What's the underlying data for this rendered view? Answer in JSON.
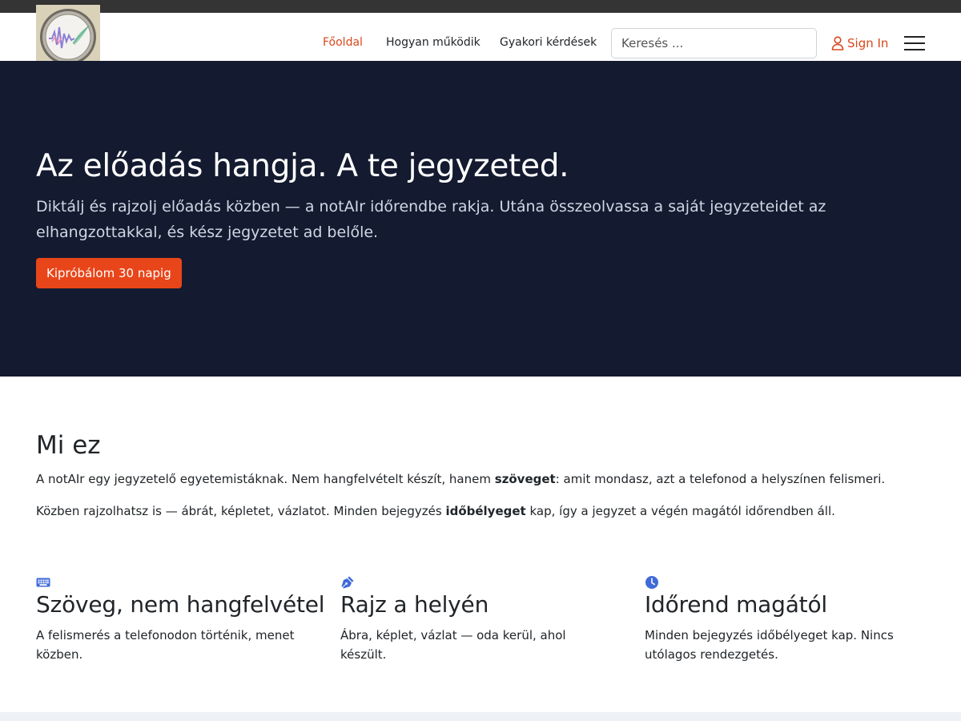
{
  "nav": {
    "items": [
      {
        "label": "Főoldal",
        "active": true
      },
      {
        "label": "Hogyan működik",
        "active": false
      },
      {
        "label": "Gyakori kérdések",
        "active": false
      }
    ],
    "search_placeholder": "Keresés ...",
    "signin_label": "Sign In",
    "accent_color": "#d9481b"
  },
  "hero": {
    "title": "Az előadás hangja. A te jegyzeted.",
    "subtitle": "Diktálj és rajzolj előadás közben — a notAIr időrendbe rakja. Utána összeolvassa a saját jegyzeteidet az elhangzottakkal, és kész jegyzetet ad belőle.",
    "cta_label": "Kipróbálom 30 napig",
    "background_color": "#141b30",
    "cta_color": "#e8461a"
  },
  "about": {
    "title": "Mi ez",
    "p1_before": "A notAIr egy jegyzetelő egyetemistáknak. Nem hangfelvételt készít, hanem ",
    "p1_bold": "szöveget",
    "p1_after": ": amit mondasz, azt a telefonod a helyszínen felismeri.",
    "p2_before": "Közben rajzolhatsz is — ábrát, képletet, vázlatot. Minden bejegyzés ",
    "p2_bold": "időbélyeget",
    "p2_after": " kap, így a jegyzet a végén magától időrendben áll."
  },
  "features": [
    {
      "icon": "keyboard-icon",
      "title": "Szöveg, nem hangfelvétel",
      "text": "A felismerés a telefonodon történik, menet közben."
    },
    {
      "icon": "pen-nib-icon",
      "title": "Rajz a helyén",
      "text": "Ábra, képlet, vázlat — oda kerül, ahol készült."
    },
    {
      "icon": "clock-icon",
      "title": "Időrend magától",
      "text": "Minden bejegyzés időbélyeget kap. Nincs utólagos rendezgetés."
    }
  ],
  "icon_color": "#3f6ad8"
}
